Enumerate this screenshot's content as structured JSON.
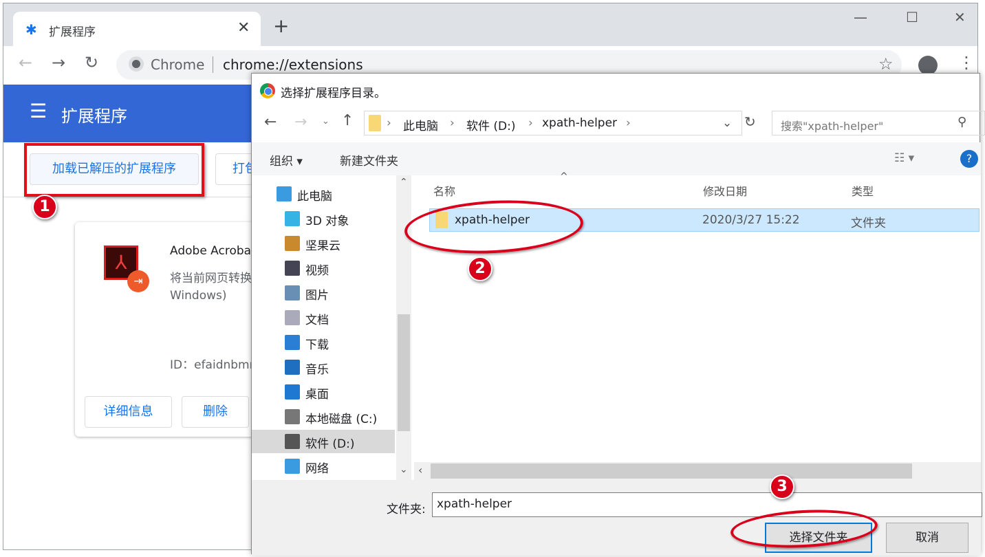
{
  "browser": {
    "tab": {
      "title": "扩展程序",
      "icon": "puzzle-icon"
    },
    "new_tab": "+",
    "omnibox": {
      "site": "Chrome",
      "url": "chrome://extensions"
    }
  },
  "extensions_page": {
    "title": "扩展程序",
    "load_unpacked": "加载已解压的扩展程序",
    "pack": "打包",
    "card": {
      "name": "Adobe Acroba",
      "desc1": "将当前网页转换",
      "desc2": "Windows)",
      "id": "ID：efaidnbmn",
      "details": "详细信息",
      "remove": "删除"
    }
  },
  "dialog": {
    "title": "选择扩展程序目录。",
    "breadcrumb": [
      "此电脑",
      "软件 (D:)",
      "xpath-helper"
    ],
    "search_placeholder": "搜索\"xpath-helper\"",
    "toolbar": {
      "organize": "组织 ▾",
      "new_folder": "新建文件夹"
    },
    "nav_items": [
      {
        "label": "此电脑",
        "icon": "computer-icon",
        "color": "#3a9be0"
      },
      {
        "label": "3D 对象",
        "icon": "cube-3d-icon",
        "color": "#34b3e4"
      },
      {
        "label": "坚果云",
        "icon": "nut-cloud-icon",
        "color": "#c98a2e"
      },
      {
        "label": "视频",
        "icon": "video-icon",
        "color": "#445"
      },
      {
        "label": "图片",
        "icon": "pictures-icon",
        "color": "#6a8fb5"
      },
      {
        "label": "文档",
        "icon": "documents-icon",
        "color": "#aab"
      },
      {
        "label": "下载",
        "icon": "download-icon",
        "color": "#2a7fd4"
      },
      {
        "label": "音乐",
        "icon": "music-icon",
        "color": "#1f6fc0"
      },
      {
        "label": "桌面",
        "icon": "desktop-icon",
        "color": "#1f78d1"
      },
      {
        "label": "本地磁盘 (C:)",
        "icon": "drive-c-icon",
        "color": "#777"
      },
      {
        "label": "软件 (D:)",
        "icon": "drive-d-icon",
        "color": "#555",
        "selected": true
      },
      {
        "label": "网络",
        "icon": "network-icon",
        "color": "#3a9be0"
      }
    ],
    "columns": [
      "名称",
      "修改日期",
      "类型"
    ],
    "rows": [
      {
        "name": "xpath-helper",
        "date": "2020/3/27 15:22",
        "type": "文件夹"
      }
    ],
    "folder_label": "文件夹:",
    "folder_value": "xpath-helper",
    "select_button": "选择文件夹",
    "cancel_button": "取消"
  },
  "annotations": {
    "step1": "1",
    "step2": "2",
    "step3": "3",
    "color": "#d9001b"
  }
}
